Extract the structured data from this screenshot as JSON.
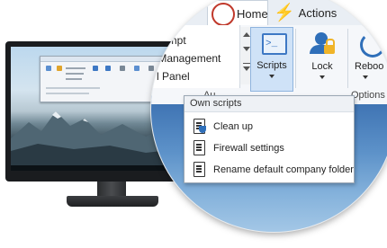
{
  "ribbon": {
    "tabs": [
      {
        "label": "Home",
        "icon": "home-logo-icon"
      },
      {
        "label": "Actions",
        "icon": "lightning-bolt-icon"
      }
    ],
    "list_items": [
      "rompt",
      "r Management",
      "l Panel"
    ],
    "group_label_left": "Au",
    "group_label_right": "Options",
    "buttons": {
      "scripts": {
        "label": "Scripts",
        "icon": "console-icon"
      },
      "lock": {
        "label": "Lock",
        "icon": "user-lock-icon"
      },
      "reboot": {
        "label": "Reboo",
        "icon": "reboot-icon"
      }
    }
  },
  "dropdown": {
    "header": "Own scripts",
    "items": [
      {
        "label": "Clean up",
        "icon": "script-shield-icon"
      },
      {
        "label": "Firewall settings",
        "icon": "script-icon"
      },
      {
        "label": "Rename default company folder",
        "icon": "script-icon"
      }
    ]
  },
  "colors": {
    "accent_blue": "#2f6fb9",
    "selected_button_bg": "#cfe2f7",
    "actions_bolt": "#f5a623",
    "lock_pad": "#f0b428"
  }
}
